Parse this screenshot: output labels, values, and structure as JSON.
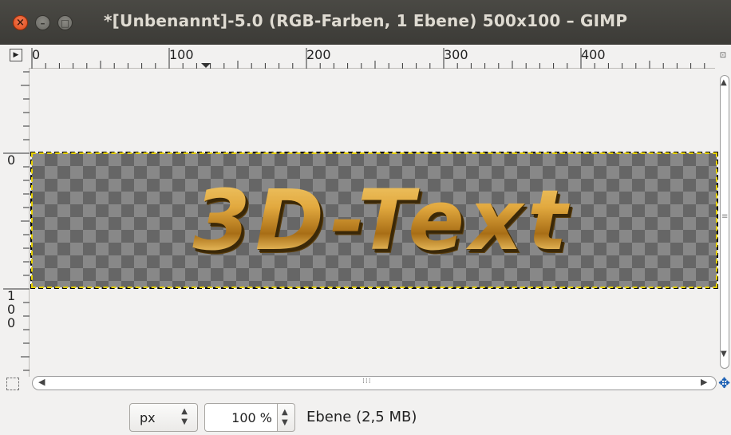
{
  "window": {
    "title": "*[Unbenannt]-5.0 (RGB-Farben, 1 Ebene) 500x100 – GIMP",
    "buttons": {
      "close": "×",
      "minimize": "–",
      "maximize": "□"
    }
  },
  "rulers": {
    "horizontal": [
      "0",
      "100",
      "200",
      "300",
      "400"
    ],
    "vertical": [
      "0",
      "1",
      "0",
      "0"
    ]
  },
  "canvas": {
    "image_text": "3D-Text"
  },
  "statusbar": {
    "unit": "px",
    "zoom": "100 %",
    "layer_info": "Ebene (2,5 MB)"
  },
  "colors": {
    "titlebar": "#3c3b37",
    "close_button": "#df4a16",
    "selection_dash": "#e8d200",
    "navigate_icon": "#1a5fb4"
  }
}
